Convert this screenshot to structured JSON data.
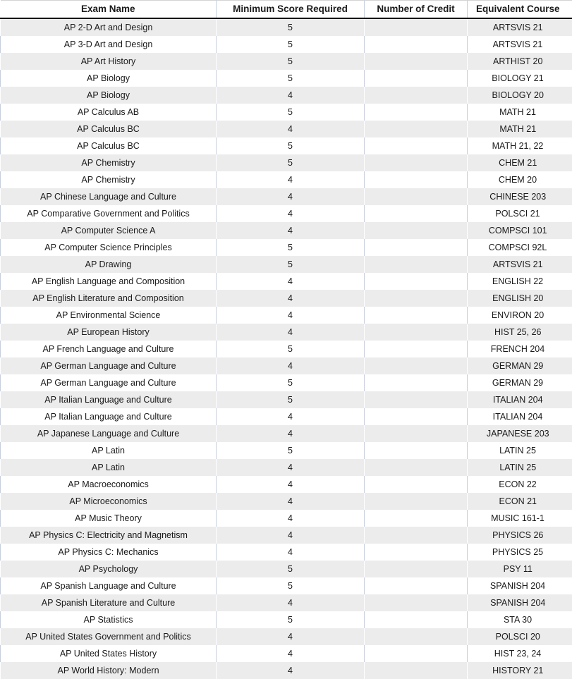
{
  "table": {
    "columns": [
      {
        "key": "exam",
        "label": "Exam Name"
      },
      {
        "key": "score",
        "label": "Minimum Score Required"
      },
      {
        "key": "credit",
        "label": "Number of Credit"
      },
      {
        "key": "course",
        "label": "Equivalent Course"
      }
    ],
    "rows": [
      {
        "exam": "AP 2-D Art and Design",
        "score": "5",
        "credit": "",
        "course": "ARTSVIS 21"
      },
      {
        "exam": "AP 3-D Art and Design",
        "score": "5",
        "credit": "",
        "course": "ARTSVIS 21"
      },
      {
        "exam": "AP Art History",
        "score": "5",
        "credit": "",
        "course": "ARTHIST 20"
      },
      {
        "exam": "AP Biology",
        "score": "5",
        "credit": "",
        "course": "BIOLOGY 21"
      },
      {
        "exam": "AP Biology",
        "score": "4",
        "credit": "",
        "course": "BIOLOGY 20"
      },
      {
        "exam": "AP Calculus AB",
        "score": "5",
        "credit": "",
        "course": "MATH 21"
      },
      {
        "exam": "AP Calculus BC",
        "score": "4",
        "credit": "",
        "course": "MATH 21"
      },
      {
        "exam": "AP Calculus BC",
        "score": "5",
        "credit": "",
        "course": "MATH 21, 22"
      },
      {
        "exam": "AP Chemistry",
        "score": "5",
        "credit": "",
        "course": "CHEM 21"
      },
      {
        "exam": "AP Chemistry",
        "score": "4",
        "credit": "",
        "course": "CHEM 20"
      },
      {
        "exam": "AP Chinese Language and Culture",
        "score": "4",
        "credit": "",
        "course": "CHINESE 203"
      },
      {
        "exam": "AP Comparative Government and Politics",
        "score": "4",
        "credit": "",
        "course": "POLSCI 21"
      },
      {
        "exam": "AP Computer Science A",
        "score": "4",
        "credit": "",
        "course": "COMPSCI 101"
      },
      {
        "exam": "AP Computer Science Principles",
        "score": "5",
        "credit": "",
        "course": "COMPSCI 92L"
      },
      {
        "exam": "AP Drawing",
        "score": "5",
        "credit": "",
        "course": "ARTSVIS 21"
      },
      {
        "exam": "AP English Language and Composition",
        "score": "4",
        "credit": "",
        "course": "ENGLISH 22"
      },
      {
        "exam": "AP English Literature and Composition",
        "score": "4",
        "credit": "",
        "course": "ENGLISH 20"
      },
      {
        "exam": "AP Environmental Science",
        "score": "4",
        "credit": "",
        "course": "ENVIRON 20"
      },
      {
        "exam": "AP European History",
        "score": "4",
        "credit": "",
        "course": "HIST 25, 26"
      },
      {
        "exam": "AP French Language and Culture",
        "score": "5",
        "credit": "",
        "course": "FRENCH 204"
      },
      {
        "exam": "AP German Language and Culture",
        "score": "4",
        "credit": "",
        "course": "GERMAN 29"
      },
      {
        "exam": "AP German Language and Culture",
        "score": "5",
        "credit": "",
        "course": "GERMAN 29"
      },
      {
        "exam": "AP Italian Language and Culture",
        "score": "5",
        "credit": "",
        "course": "ITALIAN 204"
      },
      {
        "exam": "AP Italian Language and Culture",
        "score": "4",
        "credit": "",
        "course": "ITALIAN 204"
      },
      {
        "exam": "AP Japanese Language and Culture",
        "score": "4",
        "credit": "",
        "course": "JAPANESE 203"
      },
      {
        "exam": "AP Latin",
        "score": "5",
        "credit": "",
        "course": "LATIN 25"
      },
      {
        "exam": "AP Latin",
        "score": "4",
        "credit": "",
        "course": "LATIN 25"
      },
      {
        "exam": "AP Macroeconomics",
        "score": "4",
        "credit": "",
        "course": "ECON 22"
      },
      {
        "exam": "AP Microeconomics",
        "score": "4",
        "credit": "",
        "course": "ECON 21"
      },
      {
        "exam": "AP Music Theory",
        "score": "4",
        "credit": "",
        "course": "MUSIC 161-1"
      },
      {
        "exam": "AP Physics C: Electricity and Magnetism",
        "score": "4",
        "credit": "",
        "course": "PHYSICS 26"
      },
      {
        "exam": "AP Physics C: Mechanics",
        "score": "4",
        "credit": "",
        "course": "PHYSICS 25"
      },
      {
        "exam": "AP Psychology",
        "score": "5",
        "credit": "",
        "course": "PSY 11"
      },
      {
        "exam": "AP Spanish Language and Culture",
        "score": "5",
        "credit": "",
        "course": "SPANISH 204"
      },
      {
        "exam": "AP Spanish Literature and Culture",
        "score": "4",
        "credit": "",
        "course": "SPANISH 204"
      },
      {
        "exam": "AP Statistics",
        "score": "5",
        "credit": "",
        "course": "STA 30"
      },
      {
        "exam": "AP United States Government and Politics",
        "score": "4",
        "credit": "",
        "course": "POLSCI 20"
      },
      {
        "exam": "AP United States History",
        "score": "4",
        "credit": "",
        "course": "HIST 23, 24"
      },
      {
        "exam": "AP World History: Modern",
        "score": "4",
        "credit": "",
        "course": "HISTORY 21"
      }
    ]
  },
  "colors": {
    "row_banding": "#ececec",
    "row_default": "#ffffff",
    "header_rule": "#000000",
    "column_divider": "#c8cedd",
    "text": "#1a1a1a"
  }
}
